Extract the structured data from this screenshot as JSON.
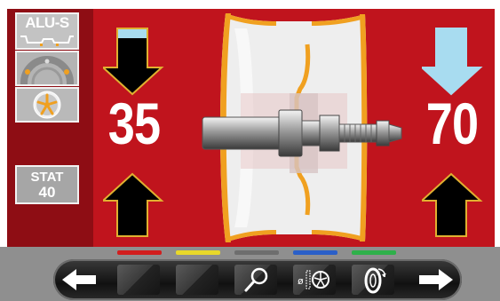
{
  "sidebar": {
    "program_button_label": "ALU-S",
    "stat_button_line1": "STAT",
    "stat_button_line2": "40"
  },
  "readout": {
    "left_value": "35",
    "right_value": "70"
  },
  "colors": {
    "background_red": "#c0141d",
    "sidebar_red": "#8e0d14",
    "arrow_black": "#000000",
    "arrow_outline": "#e0b030",
    "arrow_light_blue": "#a8dcf0",
    "rim_orange": "#f0a020",
    "indicator_red": "#d21e1e",
    "indicator_yellow": "#e8d82a",
    "indicator_gray": "#6e6e6e",
    "indicator_blue": "#2a5fc8",
    "indicator_green": "#2fb04a"
  },
  "indicators": [
    "red",
    "yellow",
    "gray",
    "blue",
    "green"
  ],
  "bottom_bar": {
    "buttons": [
      {
        "name": "back-arrow-button",
        "icon": "arrow-left-icon"
      },
      {
        "name": "blank-button-1",
        "icon": "blank"
      },
      {
        "name": "blank-button-2",
        "icon": "blank"
      },
      {
        "name": "search-button",
        "icon": "magnifier-icon"
      },
      {
        "name": "wheel-diameter-button",
        "icon": "wheel-diameter-icon"
      },
      {
        "name": "tire-rotation-button",
        "icon": "tire-rotation-icon"
      },
      {
        "name": "forward-arrow-button",
        "icon": "arrow-right-icon"
      }
    ],
    "wheel_diameter_symbol": "ø"
  }
}
